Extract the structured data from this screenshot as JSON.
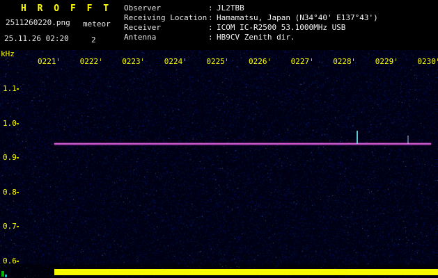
{
  "header": {
    "title": "H R O F F T",
    "filename": "2511260220.png",
    "mode": "meteor",
    "datetime": "25.11.26 02:20",
    "count": "2",
    "separator": ":",
    "info": [
      {
        "label": "Observer",
        "value": "JL2TBB"
      },
      {
        "label": "Receiving Location",
        "value": "Hamamatsu, Japan (N34°40' E137°43')"
      },
      {
        "label": "Receiver",
        "value": "ICOM IC-R2500 53.1000MHz USB"
      },
      {
        "label": "Antenna",
        "value": "HB9CV Zenith dir."
      }
    ]
  },
  "chart_data": {
    "type": "heatmap",
    "title": "HROFFT",
    "xlabel": "",
    "ylabel": "kHz",
    "x_ticks": [
      "0221",
      "0222",
      "0223",
      "0224",
      "0225",
      "0226",
      "0227",
      "0228",
      "0229",
      "0230"
    ],
    "y_ticks": [
      "1.1",
      "1.0",
      "0.9",
      "0.8",
      "0.7",
      "0.6"
    ],
    "y_range_khz": [
      0.6,
      1.15
    ],
    "background_color": "#000014",
    "axis_color": "#ffff00",
    "carrier": {
      "freq_khz": 0.94,
      "color": "#d055d0"
    },
    "echoes": [
      {
        "time_min": 8.35,
        "freq_khz": 0.98,
        "level": "bright"
      },
      {
        "time_min": 9.55,
        "freq_khz": 0.965,
        "level": "faint"
      }
    ],
    "signal_bar": {
      "color": "#f8f800",
      "coverage": "full width"
    }
  }
}
